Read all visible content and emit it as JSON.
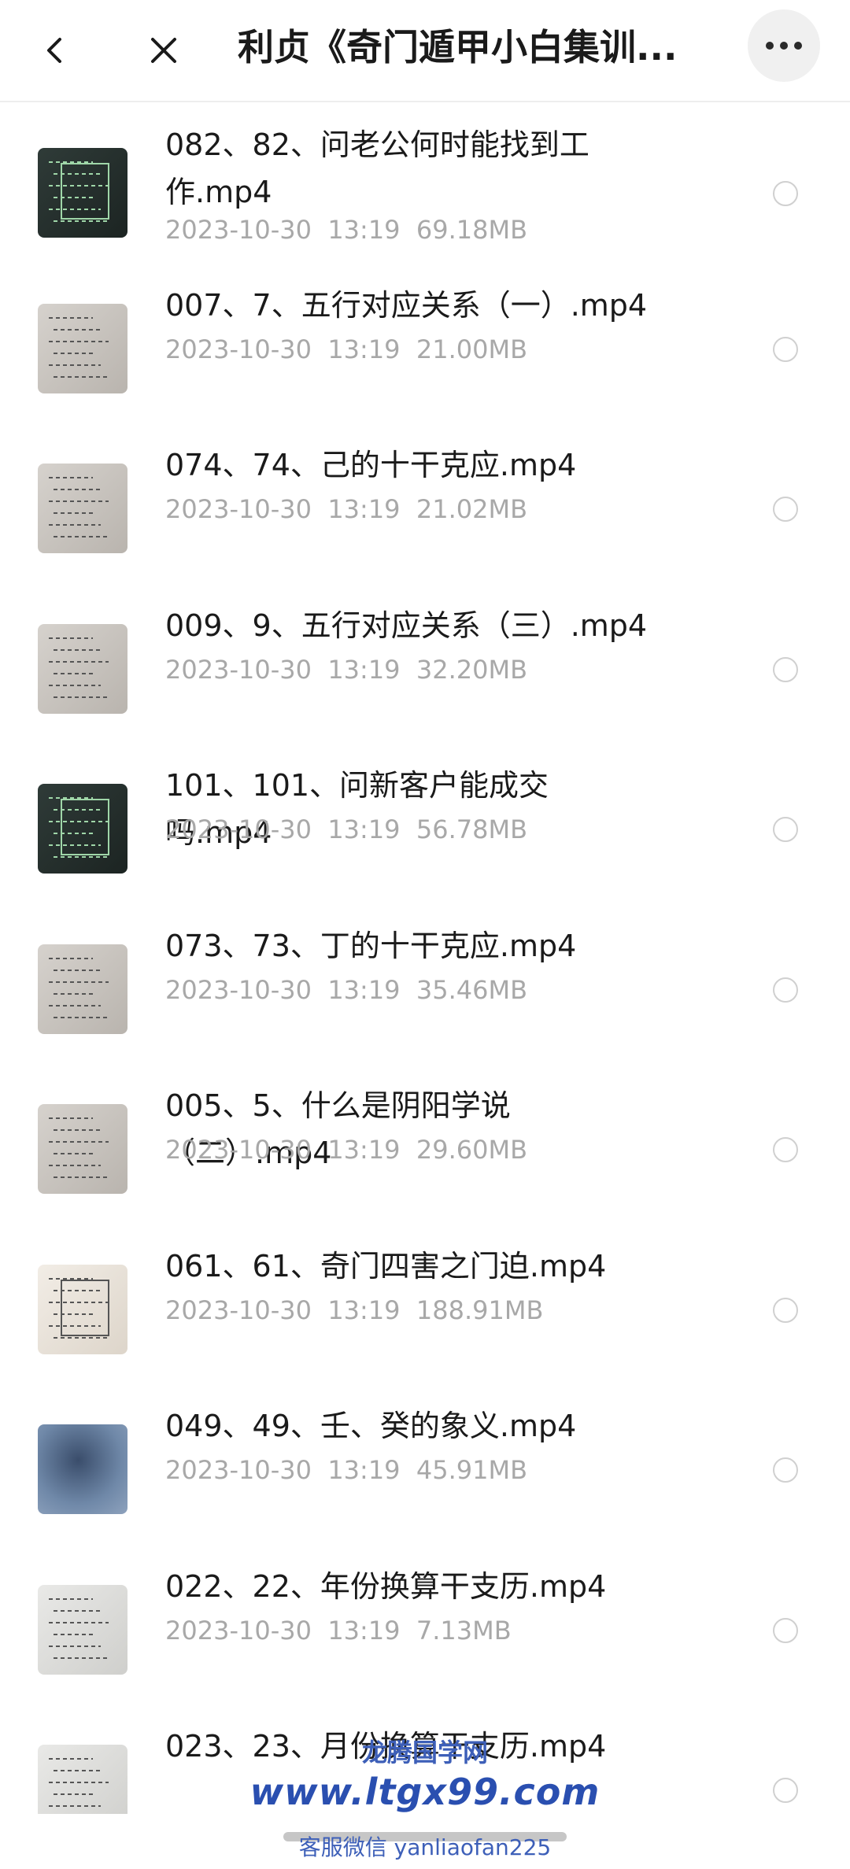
{
  "header": {
    "title": "利贞《奇门遁甲小白集训..."
  },
  "files": [
    {
      "name": "082、82、问老公何时能找到工作.mp4",
      "date": "2023-10-30",
      "time": "13:19",
      "size": "69.18MB",
      "thumb": "dark"
    },
    {
      "name": "007、7、五行对应关系（一）.mp4",
      "date": "2023-10-30",
      "time": "13:19",
      "size": "21.00MB",
      "thumb": "light"
    },
    {
      "name": "074、74、己的十干克应.mp4",
      "date": "2023-10-30",
      "time": "13:19",
      "size": "21.02MB",
      "thumb": "light"
    },
    {
      "name": "009、9、五行对应关系（三）.mp4",
      "date": "2023-10-30",
      "time": "13:19",
      "size": "32.20MB",
      "thumb": "light"
    },
    {
      "name": "101、101、问新客户能成交吗.mp4",
      "date": "2023-10-30",
      "time": "13:19",
      "size": "56.78MB",
      "thumb": "dark"
    },
    {
      "name": "073、73、丁的十干克应.mp4",
      "date": "2023-10-30",
      "time": "13:19",
      "size": "35.46MB",
      "thumb": "light"
    },
    {
      "name": "005、5、什么是阴阳学说（二）.mp4",
      "date": "2023-10-30",
      "time": "13:19",
      "size": "29.60MB",
      "thumb": "light"
    },
    {
      "name": "061、61、奇门四害之门迫.mp4",
      "date": "2023-10-30",
      "time": "13:19",
      "size": "188.91MB",
      "thumb": "paper"
    },
    {
      "name": "049、49、壬、癸的象义.mp4",
      "date": "2023-10-30",
      "time": "13:19",
      "size": "45.91MB",
      "thumb": "blue"
    },
    {
      "name": "022、22、年份换算干支历.mp4",
      "date": "2023-10-30",
      "time": "13:19",
      "size": "7.13MB",
      "thumb": "white"
    },
    {
      "name": "023、23、月份换算干支历.mp4",
      "date": "",
      "time": "",
      "size": "",
      "thumb": "white"
    }
  ],
  "watermark": {
    "line1": "龙腾国学网",
    "line2": "www.ltgx99.com",
    "line3": "客服微信 yanliaofan225"
  }
}
